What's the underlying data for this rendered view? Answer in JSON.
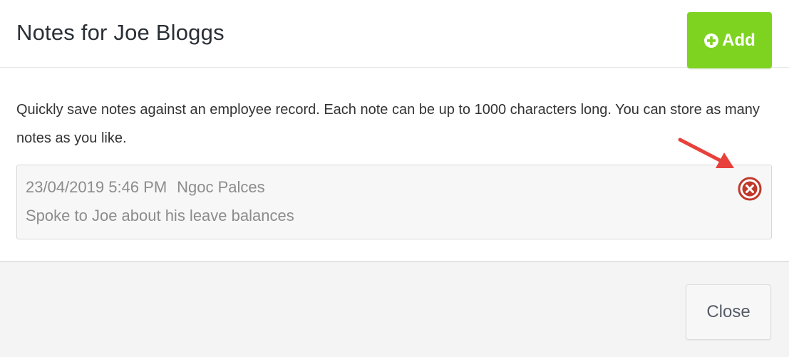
{
  "modal": {
    "title": "Notes for Joe Bloggs",
    "add_label": "Add",
    "description": "Quickly save notes against an employee record. Each note can be up to 1000 characters long. You can store as many notes as you like.",
    "close_label": "Close"
  },
  "notes": [
    {
      "timestamp": "23/04/2019 5:46 PM",
      "author": "Ngoc Palces",
      "text": "Spoke to Joe about his leave balances"
    }
  ],
  "icons": {
    "add": "plus-circle-icon",
    "delete": "close-circle-icon"
  },
  "colors": {
    "add_button": "#7ed321",
    "delete_icon": "#c0392b",
    "annotation_arrow": "#e8413c"
  }
}
